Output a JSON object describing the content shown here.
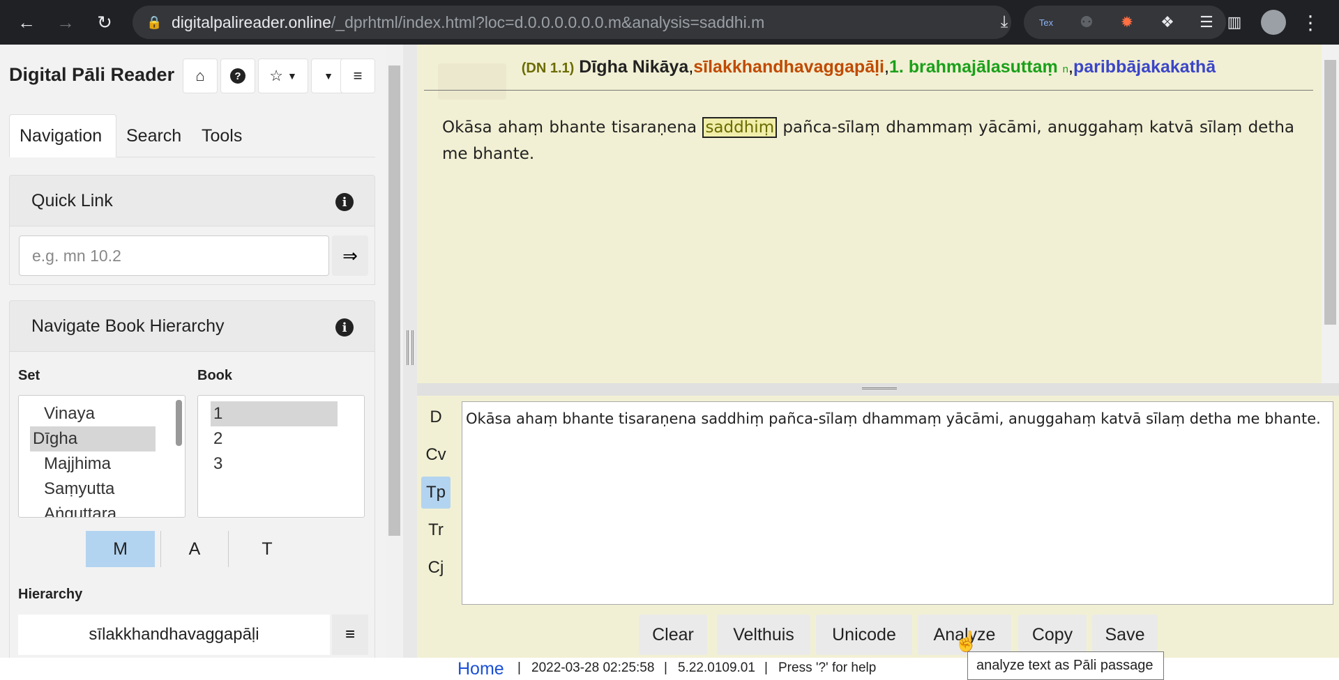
{
  "browser": {
    "url_host": "digitalpalireader.online",
    "url_path": "/_dprhtml/index.html?loc=d.0.0.0.0.0.0.m&analysis=saddhi.m",
    "ext_label": "Tex"
  },
  "sidebar": {
    "brand": "Digital Pāli Reader",
    "tabs": [
      "Navigation",
      "Search",
      "Tools"
    ],
    "quick_link": {
      "title": "Quick Link",
      "placeholder": "e.g. mn 10.2",
      "go_icon": "⇒"
    },
    "hierarchy_panel": {
      "title": "Navigate Book Hierarchy",
      "set_label": "Set",
      "book_label": "Book",
      "sets": [
        "Vinaya",
        "Dīgha",
        "Majjhima",
        "Saṃyutta",
        "Aṅguttara"
      ],
      "selected_set": "Dīgha",
      "books": [
        "1",
        "2",
        "3"
      ],
      "selected_book": "1",
      "mat": [
        "M",
        "A",
        "T"
      ],
      "mat_selected": "M",
      "hierarchy_label": "Hierarchy",
      "hierarchy_item": "sīlakkhandhavaggapāḷi"
    }
  },
  "reader": {
    "ref": "(DN 1.1)",
    "nikaya": "Dīgha Nikāya",
    "vagga": "sīlakkhandhavaggapāḷi",
    "sutta": "1. brahmajālasuttaṃ",
    "sutta_marker": "n",
    "section": "paribbājakakathā",
    "passage_before": "Okāsa ahaṃ bhante tisaraṇena",
    "passage_highlight": "saddhiṃ",
    "passage_after": "pañca-sīlaṃ dhammaṃ yācāmi, anuggahaṃ katvā sīlaṃ detha me bhante."
  },
  "analysis": {
    "side_tabs": [
      "D",
      "Cv",
      "Tp",
      "Tr",
      "Cj"
    ],
    "active_side_tab": "Tp",
    "text": "Okāsa ahaṃ bhante tisaraṇena saddhiṃ pañca-sīlaṃ dhammaṃ yācāmi, anuggahaṃ katvā sīlaṃ detha me bhante.",
    "buttons": [
      "Clear",
      "Velthuis",
      "Unicode",
      "Analyze",
      "Copy",
      "Save"
    ],
    "tooltip": "analyze text as Pāli passage"
  },
  "status": {
    "home": "Home",
    "datetime": "2022-03-28 02:25:58",
    "version": "5.22.0109.01",
    "help": "Press '?' for help"
  },
  "colors": {
    "vagga": "#c04a00",
    "sutta": "#1aa01a",
    "section": "#3b46c8",
    "ref": "#6b6b00",
    "active_tab": "#b3d4f0",
    "reader_bg": "#f2f0d4"
  }
}
